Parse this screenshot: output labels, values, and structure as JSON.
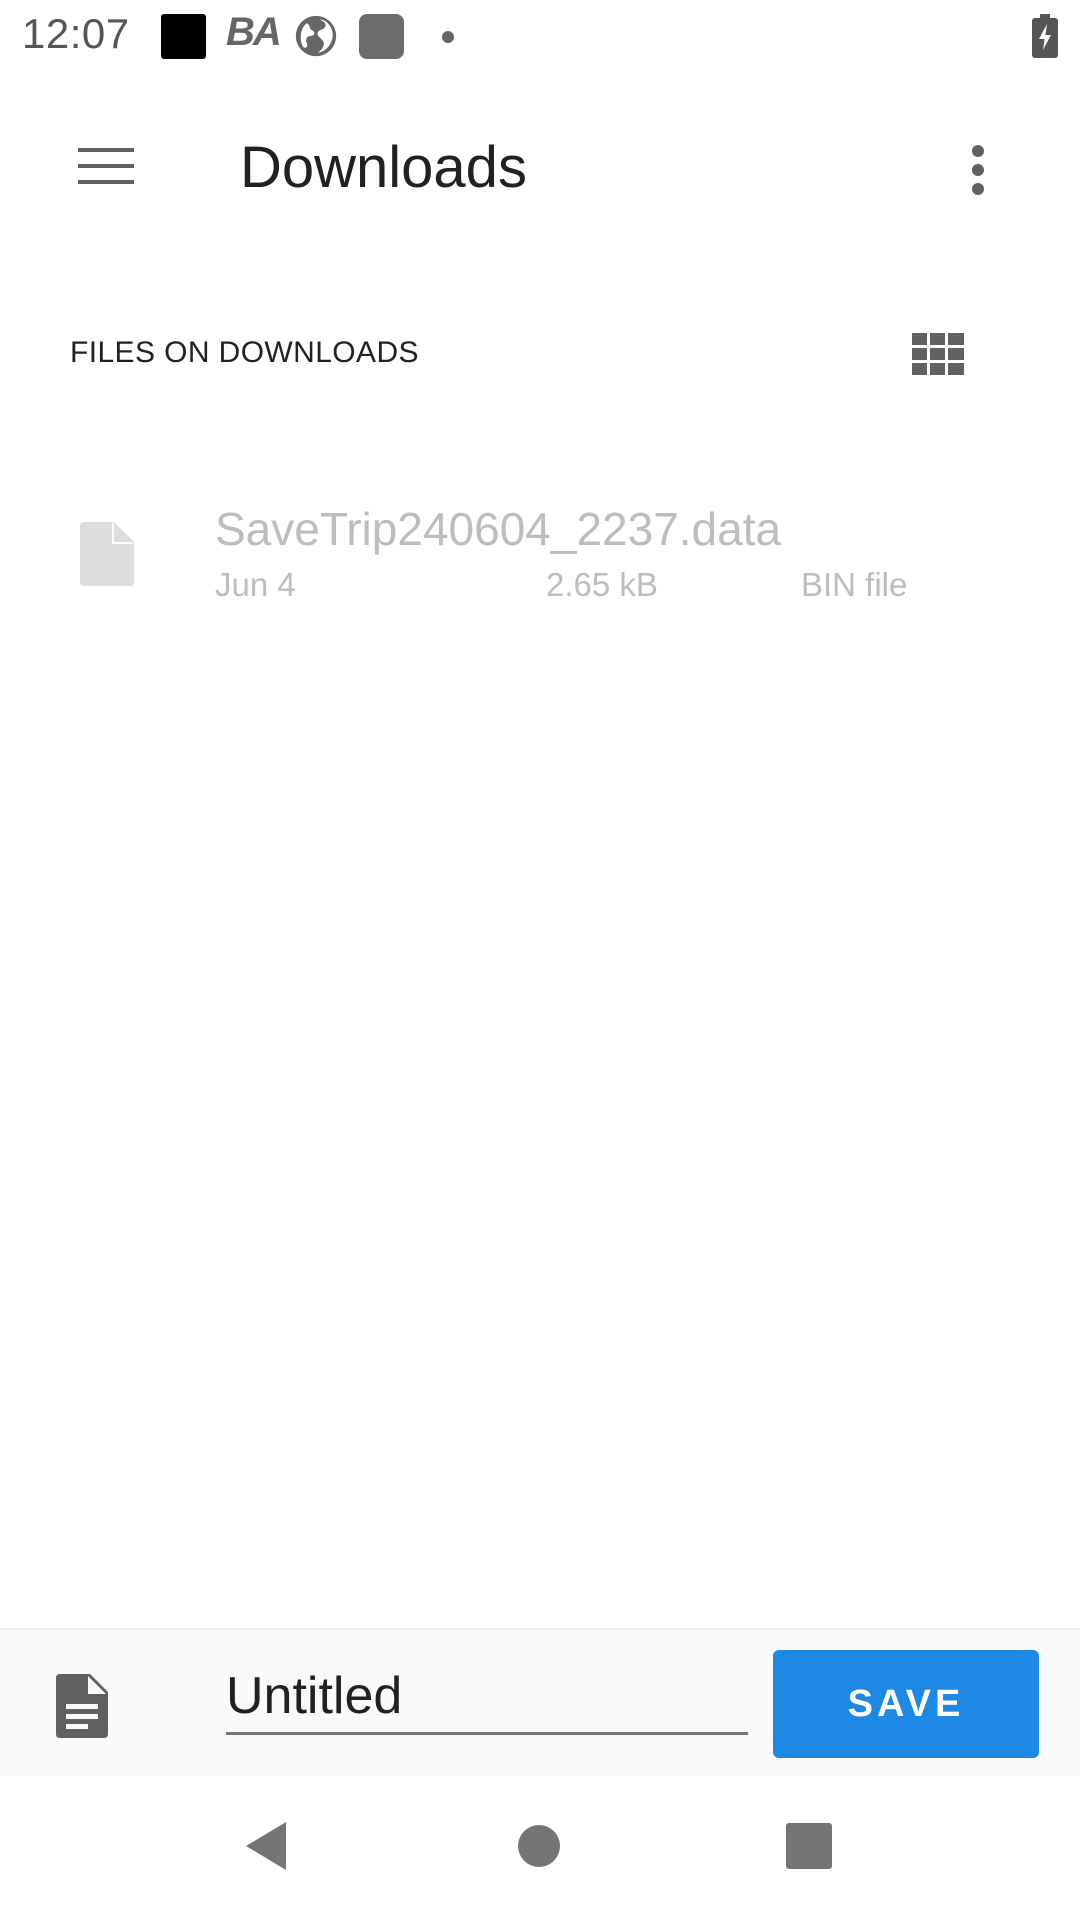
{
  "status_bar": {
    "time": "12:07",
    "notification_text": "BA",
    "icons": [
      "black-square-icon",
      "ba-icon",
      "globe-icon",
      "gray-square-icon",
      "dot-icon",
      "battery-charging-icon"
    ]
  },
  "app_bar": {
    "title": "Downloads",
    "menu_icon": "hamburger-menu-icon",
    "overflow_icon": "more-vert-icon"
  },
  "section": {
    "header": "FILES ON DOWNLOADS",
    "view_toggle_icon": "grid-view-icon"
  },
  "files": [
    {
      "name": "SaveTrip240604_2237.data",
      "date": "Jun 4",
      "size": "2.65 kB",
      "type": "BIN file",
      "icon": "file-icon"
    }
  ],
  "save_bar": {
    "icon": "document-icon",
    "filename_value": "Untitled",
    "save_label": "SAVE"
  },
  "nav_bar": {
    "icons": [
      "back-icon",
      "home-icon",
      "recents-icon"
    ]
  },
  "colors": {
    "accent": "#1e88e5",
    "title_text": "#212121",
    "disabled_text": "#bdbdbd"
  }
}
